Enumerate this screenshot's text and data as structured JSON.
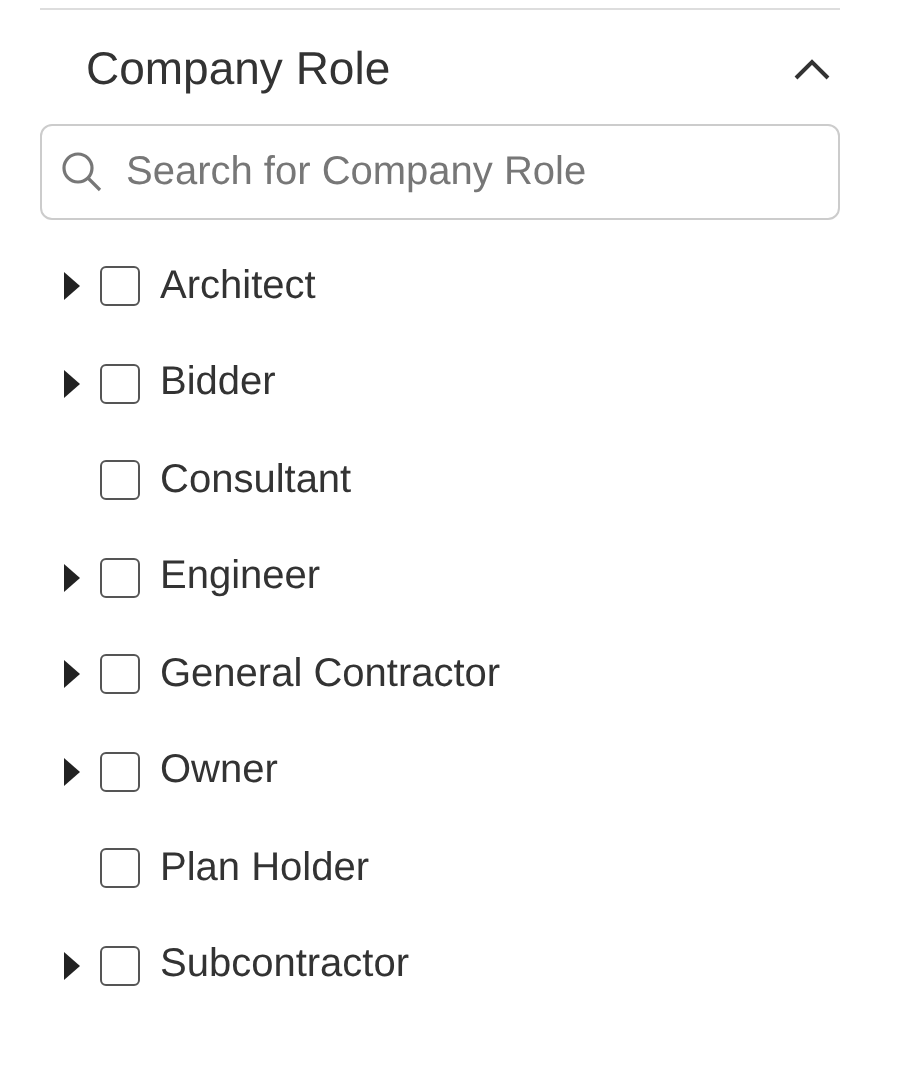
{
  "filter": {
    "title": "Company Role",
    "expanded": true,
    "search": {
      "placeholder": "Search for Company Role"
    },
    "options": [
      {
        "label": "Architect",
        "expandable": true,
        "expanded": false,
        "checked": false
      },
      {
        "label": "Bidder",
        "expandable": true,
        "expanded": false,
        "checked": false
      },
      {
        "label": "Consultant",
        "expandable": false,
        "checked": false
      },
      {
        "label": "Engineer",
        "expandable": true,
        "expanded": false,
        "checked": false
      },
      {
        "label": "General Contractor",
        "expandable": true,
        "expanded": false,
        "checked": false
      },
      {
        "label": "Owner",
        "expandable": true,
        "expanded": false,
        "checked": false
      },
      {
        "label": "Plan Holder",
        "expandable": false,
        "checked": false
      },
      {
        "label": "Subcontractor",
        "expandable": true,
        "expanded": false,
        "checked": false
      }
    ]
  }
}
